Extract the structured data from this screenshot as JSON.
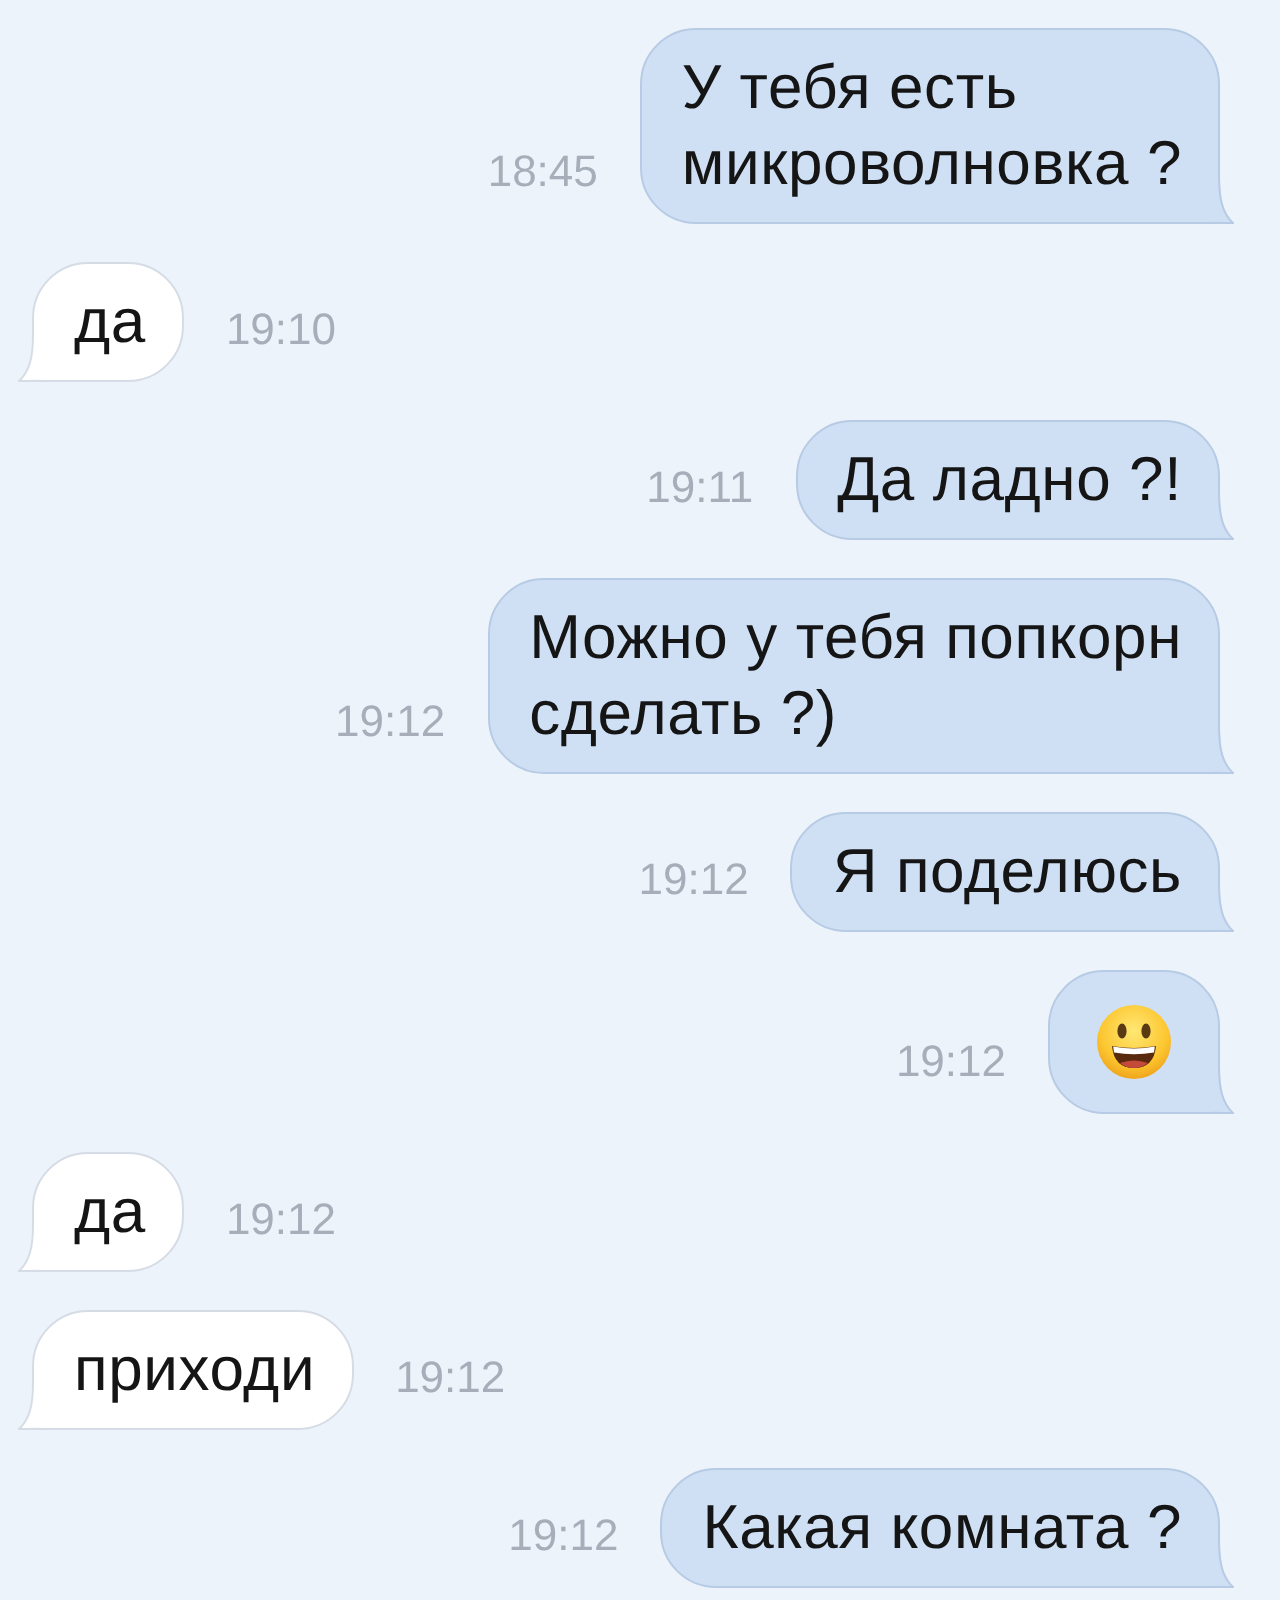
{
  "messages": [
    {
      "outgoing": true,
      "kind": "text",
      "text": "У тебя есть\nмикроволновка ?",
      "time": "18:45"
    },
    {
      "outgoing": false,
      "kind": "text",
      "text": "да",
      "time": "19:10"
    },
    {
      "outgoing": true,
      "kind": "text",
      "text": "Да ладно ?!",
      "time": "19:11"
    },
    {
      "outgoing": true,
      "kind": "text",
      "text": "Можно у тебя попкорн\nсделать ?)",
      "time": "19:12"
    },
    {
      "outgoing": true,
      "kind": "text",
      "text": "Я поделюсь",
      "time": "19:12"
    },
    {
      "outgoing": true,
      "kind": "emoji",
      "time": "19:12"
    },
    {
      "outgoing": false,
      "kind": "text",
      "text": "да",
      "time": "19:12"
    },
    {
      "outgoing": false,
      "kind": "text",
      "text": "приходи",
      "time": "19:12"
    },
    {
      "outgoing": true,
      "kind": "text",
      "text": "Какая комната ?",
      "time": "19:12"
    }
  ]
}
